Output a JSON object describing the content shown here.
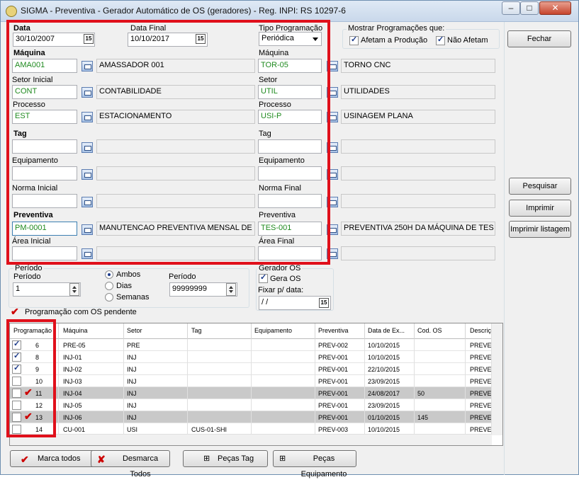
{
  "window": {
    "title": "SIGMA - Preventiva - Gerador Automático de OS (geradores) - Reg. INPI: RS 10297-6"
  },
  "titlebar": {
    "minimize": "–",
    "maximize": "□",
    "close": "✕"
  },
  "form": {
    "data_label": "Data",
    "data_value": "30/10/2007",
    "data_final_label": "Data Final",
    "data_final_value": "10/10/2017",
    "tipo_label": "Tipo Programação",
    "tipo_value": "Periódica",
    "mostrar_label": "Mostrar Programações que:",
    "afetam_label": "Afetam a Produção",
    "nao_afetam_label": "Não Afetam",
    "maquina_label": "Máquina",
    "maquina_code": "AMA001",
    "maquina_desc": "AMASSADOR 001",
    "maquina2_label": "Máquina",
    "maquina2_code": "TOR-05",
    "maquina2_desc": "TORNO CNC",
    "setor_label": "Setor Inicial",
    "setor_code": "CONT",
    "setor_desc": "CONTABILIDADE",
    "setor2_label": "Setor",
    "setor2_code": "UTIL",
    "setor2_desc": "UTILIDADES",
    "processo_label": "Processo",
    "processo_code": "EST",
    "processo_desc": "ESTACIONAMENTO",
    "processo2_label": "Processo",
    "processo2_code": "USI-P",
    "processo2_desc": "USINAGEM PLANA",
    "tag_label": "Tag",
    "tag2_label": "Tag",
    "equip_label": "Equipamento",
    "equip2_label": "Equipamento",
    "norma_ini_label": "Norma Inicial",
    "norma_fin_label": "Norma Final",
    "prev_label": "Preventiva",
    "prev_code": "PM-0001",
    "prev_desc": "MANUTENCAO PREVENTIVA MENSAL DE",
    "prev2_label": "Preventiva",
    "prev2_code": "TES-001",
    "prev2_desc": "PREVENTIVA 250H DA MÁQUINA DE TES",
    "area_ini_label": "Área Inicial",
    "area_fin_label": "Área Final",
    "periodo_group": "Período",
    "periodo_label": "Período",
    "periodo_value": "1",
    "ambos": "Ambos",
    "dias": "Dias",
    "semanas": "Semanas",
    "periodo2_label": "Período",
    "periodo2_value": "99999999",
    "gerador_group": "Gerador OS",
    "gera_os": "Gera OS",
    "fixar_label": "Fixar p/ data:",
    "fixar_value": " /  /",
    "pendente_label": "Programação com OS pendente",
    "cal_icon": "15"
  },
  "buttons": {
    "fechar": "Fechar",
    "pesquisar": "Pesquisar",
    "imprimir": "Imprimir",
    "imprimir_listagem": "Imprimir listagem",
    "marca_todos": "Marca todos",
    "desmarca_todos": "Desmarca Todos",
    "pecas_tag": "Peças Tag",
    "pecas_equip": "Peças Equipamento"
  },
  "grid": {
    "headers": [
      "Programação",
      "Máquina",
      "Setor",
      "Tag",
      "Equipamento",
      "Preventiva",
      "Data de Ex...",
      "Cod. OS",
      "Descriç"
    ],
    "rows": [
      {
        "checked": true,
        "pend": false,
        "gray": false,
        "cells": [
          "6",
          "PRE-05",
          "PRE",
          "",
          "",
          "PREV-002",
          "10/10/2015",
          "",
          "PREVE"
        ]
      },
      {
        "checked": true,
        "pend": false,
        "gray": false,
        "cells": [
          "8",
          "INJ-01",
          "INJ",
          "",
          "",
          "PREV-001",
          "10/10/2015",
          "",
          "PREVE"
        ]
      },
      {
        "checked": true,
        "pend": false,
        "gray": false,
        "cells": [
          "9",
          "INJ-02",
          "INJ",
          "",
          "",
          "PREV-001",
          "22/10/2015",
          "",
          "PREVE"
        ]
      },
      {
        "checked": false,
        "pend": false,
        "gray": false,
        "cells": [
          "10",
          "INJ-03",
          "INJ",
          "",
          "",
          "PREV-001",
          "23/09/2015",
          "",
          "PREVE"
        ]
      },
      {
        "checked": false,
        "pend": true,
        "gray": true,
        "cells": [
          "11",
          "INJ-04",
          "INJ",
          "",
          "",
          "PREV-001",
          "24/08/2017",
          "50",
          "PREVE"
        ]
      },
      {
        "checked": false,
        "pend": false,
        "gray": false,
        "cells": [
          "12",
          "INJ-05",
          "INJ",
          "",
          "",
          "PREV-001",
          "23/09/2015",
          "",
          "PREVE"
        ]
      },
      {
        "checked": false,
        "pend": true,
        "gray": true,
        "cells": [
          "13",
          "INJ-06",
          "INJ",
          "",
          "",
          "PREV-001",
          "01/10/2015",
          "145",
          "PREVE"
        ]
      },
      {
        "checked": false,
        "pend": false,
        "gray": false,
        "cells": [
          "14",
          "CU-001",
          "USI",
          "CUS-01-SHI",
          "",
          "PREV-003",
          "10/10/2015",
          "",
          "PREVE"
        ]
      }
    ]
  }
}
